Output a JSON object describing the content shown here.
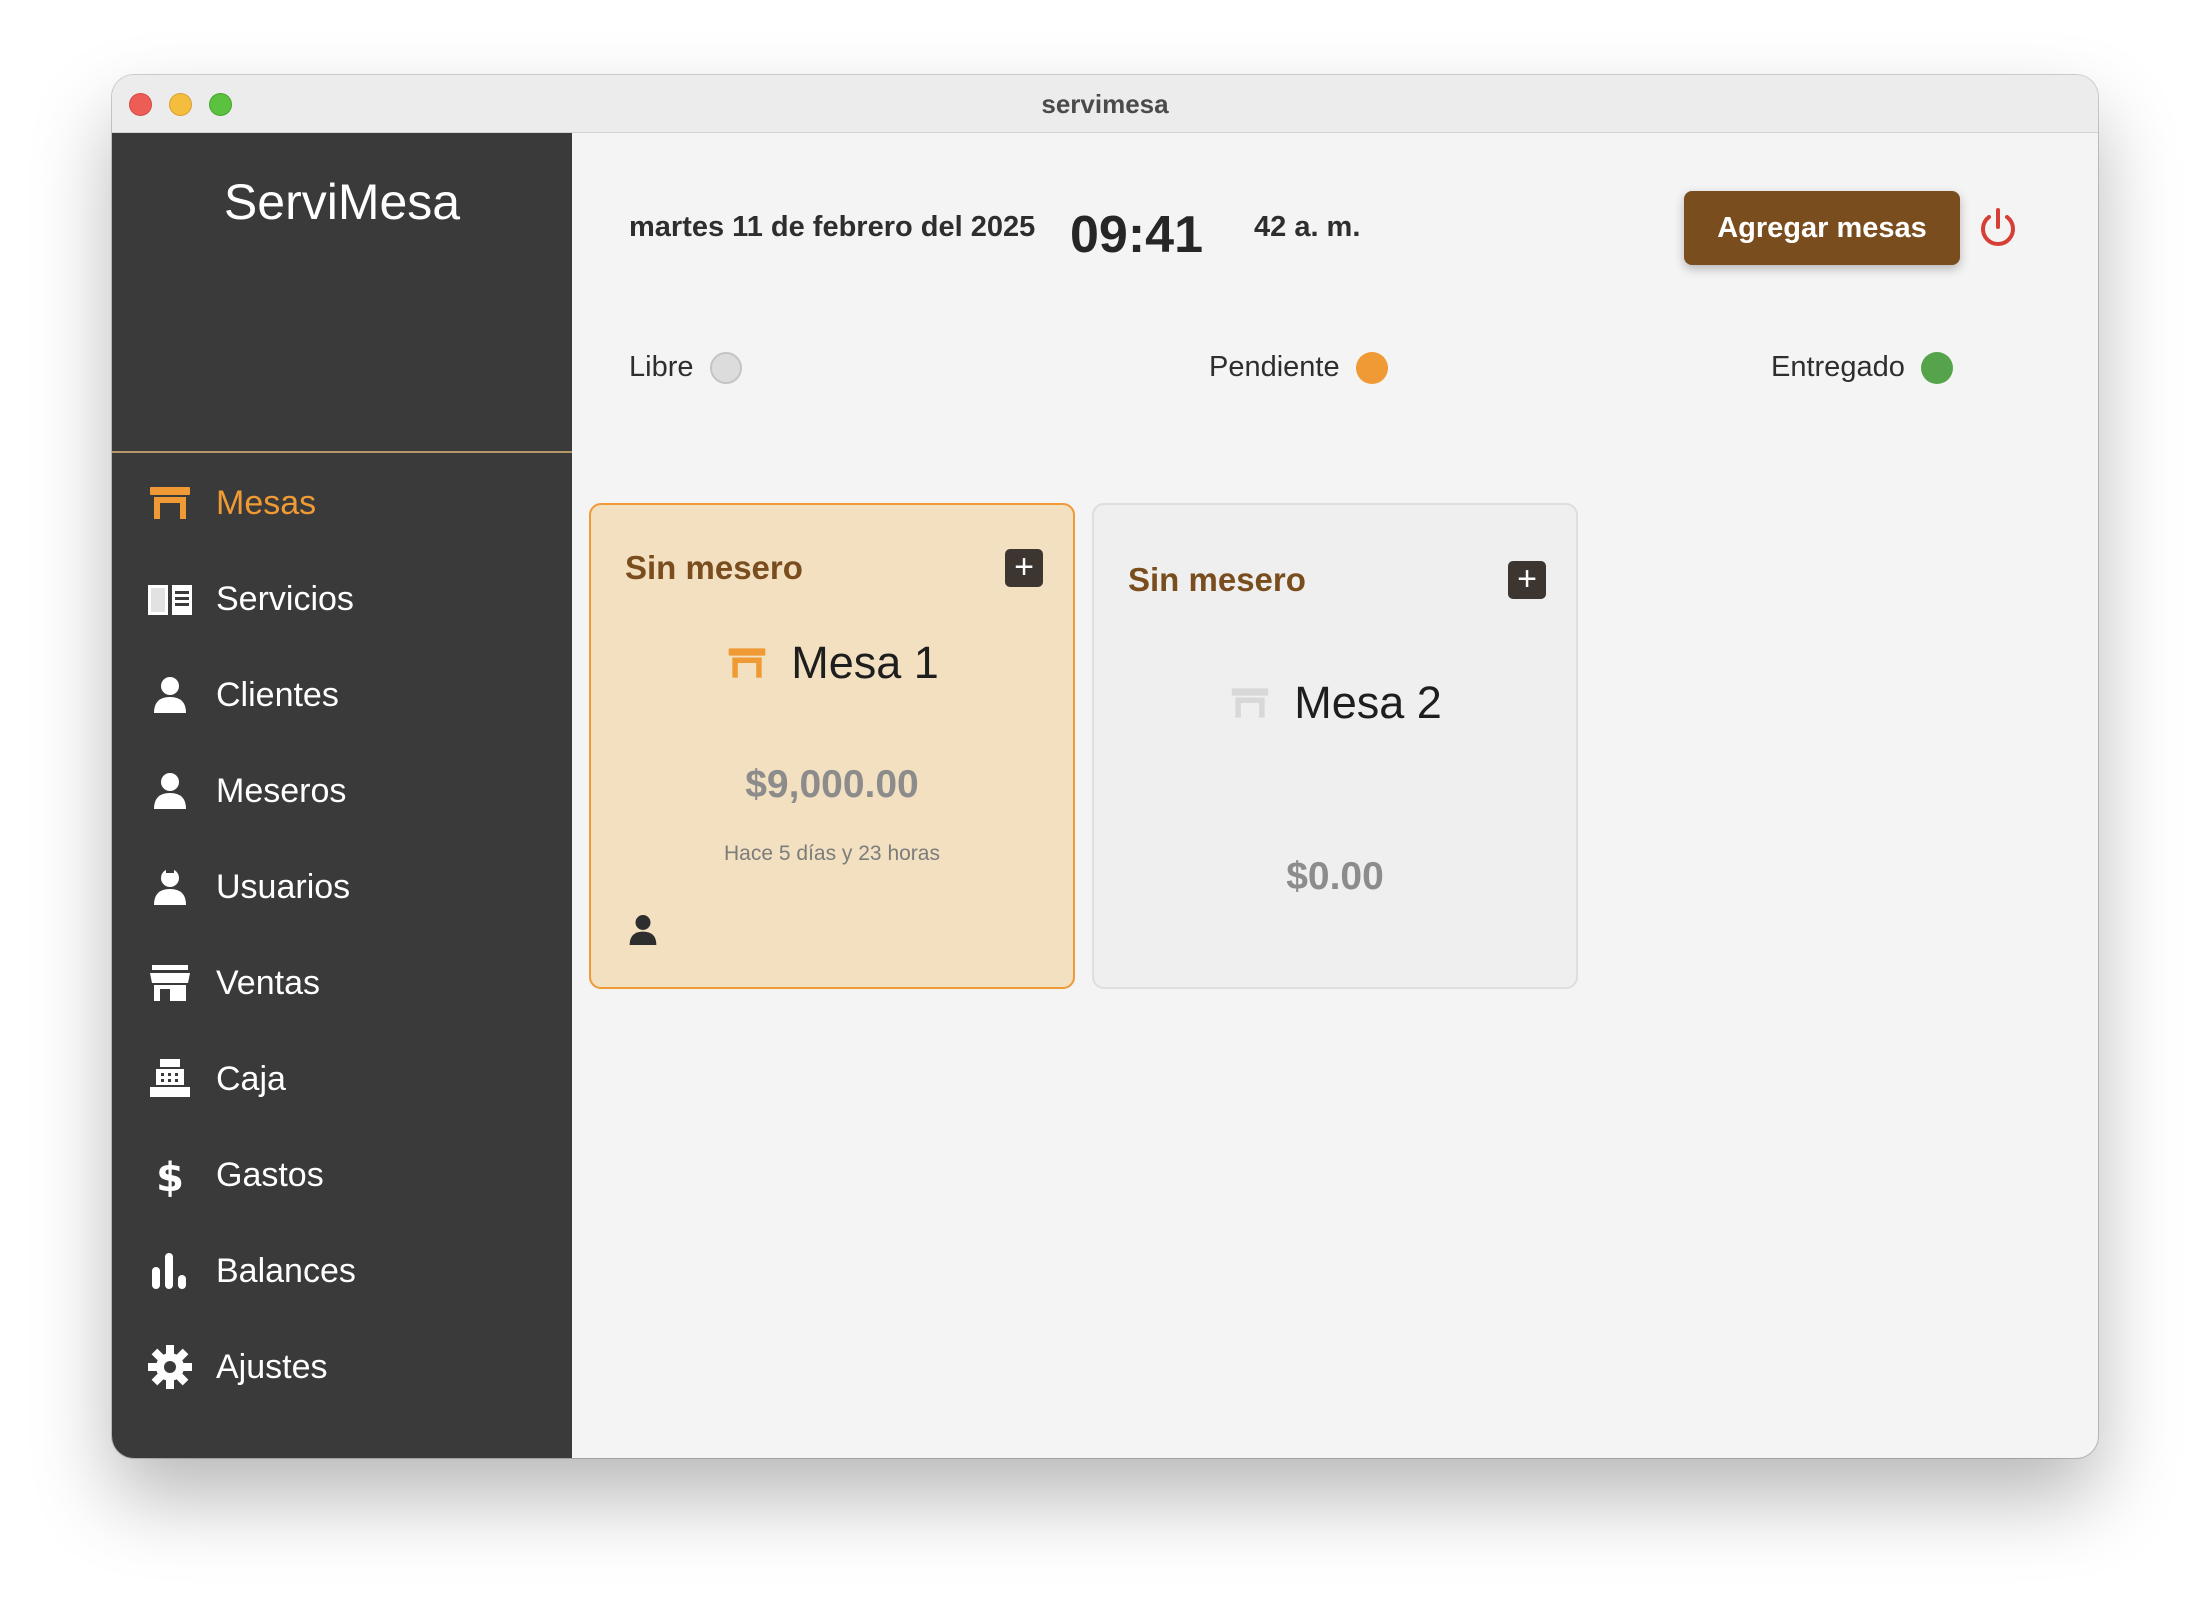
{
  "window": {
    "title": "servimesa"
  },
  "sidebar": {
    "brand": "ServiMesa",
    "items": [
      {
        "label": "Mesas",
        "icon": "table-icon",
        "active": true
      },
      {
        "label": "Servicios",
        "icon": "book-icon"
      },
      {
        "label": "Clientes",
        "icon": "person-icon"
      },
      {
        "label": "Meseros",
        "icon": "person-icon"
      },
      {
        "label": "Usuarios",
        "icon": "user-badge-icon"
      },
      {
        "label": "Ventas",
        "icon": "storefront-icon"
      },
      {
        "label": "Caja",
        "icon": "cash-register-icon"
      },
      {
        "label": "Gastos",
        "icon": "dollar-icon"
      },
      {
        "label": "Balances",
        "icon": "bar-chart-icon"
      },
      {
        "label": "Ajustes",
        "icon": "gear-icon"
      }
    ]
  },
  "header": {
    "date": "martes 11 de febrero del 2025",
    "time_hm": "09:41",
    "time_rest": "42 a. m.",
    "add_button": "Agregar mesas"
  },
  "legend": [
    {
      "label": "Libre",
      "color": "#dcdcdc"
    },
    {
      "label": "Pendiente",
      "color": "#ef9a34"
    },
    {
      "label": "Entregado",
      "color": "#55a34a"
    }
  ],
  "tables": [
    {
      "waiter": "Sin mesero",
      "name": "Mesa 1",
      "amount": "$9,000.00",
      "elapsed": "Hace 5 días y 23 horas",
      "status": "Pendiente"
    },
    {
      "waiter": "Sin mesero",
      "name": "Mesa 2",
      "amount": "$0.00",
      "status": "Libre"
    }
  ],
  "colors": {
    "accent": "#ef9a34",
    "brand_brown": "#7a4d1e",
    "sidebar_bg": "#3a3a3a",
    "power": "#d63f36"
  }
}
